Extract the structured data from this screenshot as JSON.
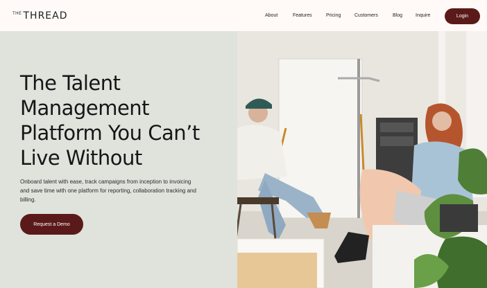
{
  "brand": {
    "prefix": "THE",
    "name": "THREAD"
  },
  "nav": {
    "links": [
      "About",
      "Features",
      "Pricing",
      "Customers",
      "Blog",
      "Inquire"
    ],
    "login_label": "Login"
  },
  "hero": {
    "headline_lines": [
      "The Talent",
      "Management",
      "Platform You Can’t",
      "Live Without"
    ],
    "subtext": "Onboard talent with ease, track campaigns from inception to invoicing and save time with one platform for reporting, collaboration tracking and billing.",
    "cta_label": "Request a Demo"
  },
  "colors": {
    "accent": "#5b1a1a",
    "hero_bg": "#dfe3dc",
    "page_bg": "#fffaf7"
  }
}
